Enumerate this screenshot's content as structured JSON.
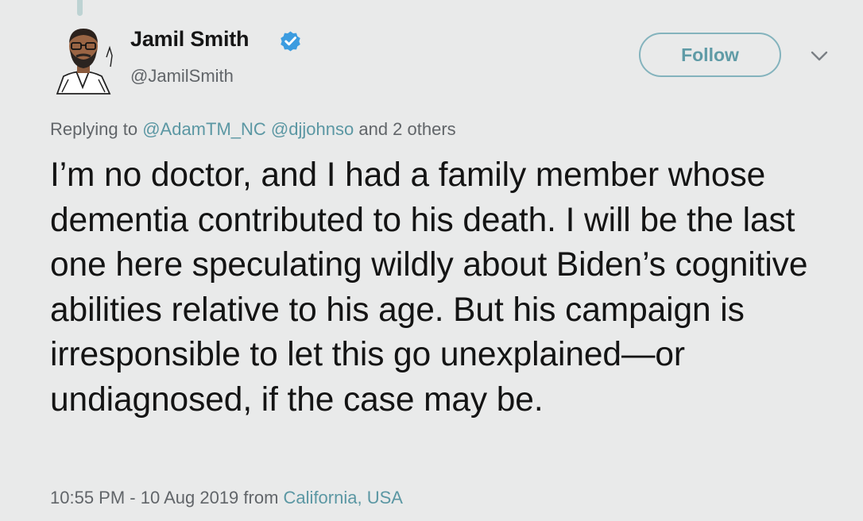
{
  "tweet": {
    "author": {
      "name": "Jamil Smith",
      "handle": "@JamilSmith",
      "verified": true
    },
    "follow_label": "Follow",
    "reply_context": {
      "prefix": "Replying to",
      "mentions": [
        "@AdamTM_NC",
        "@djjohnso"
      ],
      "suffix": "and 2 others"
    },
    "text": "I’m no doctor, and I had a family member whose dementia contributed to his death. I will be the last one here speculating wildly about Biden’s cognitive abilities relative to his age. But his campaign is irresponsible to let this go unexplained—or undiagnosed, if the case may be.",
    "timestamp": "10:55 PM - 10 Aug 2019",
    "source_prefix": "from",
    "location": "California, USA"
  },
  "icons": {
    "verified": "verified-badge-icon",
    "menu": "chevron-down-icon"
  },
  "colors": {
    "background": "#e9eaea",
    "link": "#5b97a3",
    "follow_border": "#84b3bd",
    "verified": "#3c9ce0",
    "secondary_text": "#616569"
  }
}
